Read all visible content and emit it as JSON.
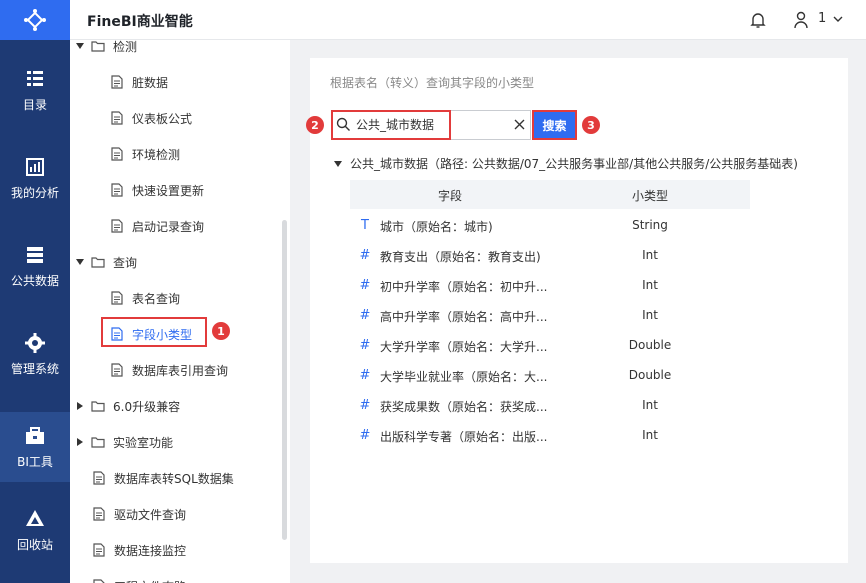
{
  "nav": {
    "items": [
      {
        "label": "目录",
        "icon": "catalog-icon"
      },
      {
        "label": "我的分析",
        "icon": "analysis-icon"
      },
      {
        "label": "公共数据",
        "icon": "public-data-icon"
      },
      {
        "label": "管理系统",
        "icon": "gear-icon"
      },
      {
        "label": "BI工具",
        "icon": "toolbox-icon"
      },
      {
        "label": "回收站",
        "icon": "recycle-icon"
      }
    ],
    "active_index": 4
  },
  "header": {
    "title": "FineBI商业智能",
    "user_count": "1"
  },
  "tree": {
    "rows": [
      {
        "text": "检测",
        "kind": "folder",
        "expanded": true
      },
      {
        "text": "脏数据",
        "kind": "doc"
      },
      {
        "text": "仪表板公式",
        "kind": "doc"
      },
      {
        "text": "环境检测",
        "kind": "doc"
      },
      {
        "text": "快速设置更新",
        "kind": "doc"
      },
      {
        "text": "启动记录查询",
        "kind": "doc"
      },
      {
        "text": "查询",
        "kind": "folder",
        "expanded": true
      },
      {
        "text": "表名查询",
        "kind": "doc"
      },
      {
        "text": "字段小类型",
        "kind": "doc",
        "selected": true
      },
      {
        "text": "数据库表引用查询",
        "kind": "doc"
      },
      {
        "text": "6.0升级兼容",
        "kind": "folder",
        "expanded": false
      },
      {
        "text": "实验室功能",
        "kind": "folder",
        "expanded": false
      },
      {
        "text": "数据库表转SQL数据集",
        "kind": "doc"
      },
      {
        "text": "驱动文件查询",
        "kind": "doc"
      },
      {
        "text": "数据连接监控",
        "kind": "doc"
      },
      {
        "text": "工程文件态路",
        "kind": "doc"
      }
    ]
  },
  "badges": [
    "1",
    "2",
    "3"
  ],
  "main": {
    "hint": "根据表名（转义）查询其字段的小类型",
    "search_value": "公共_城市数据",
    "search_button": "搜索",
    "result_title": "公共_城市数据（路径: 公共数据/07_公共服务事业部/其他公共服务/公共服务基础表)",
    "columns": [
      "字段",
      "小类型"
    ],
    "rows": [
      {
        "icon": "text-type-icon",
        "glyph": "T",
        "field": "城市（原始名：城市)",
        "type": "String"
      },
      {
        "icon": "number-type-icon",
        "glyph": "#",
        "field": "教育支出（原始名：教育支出)",
        "type": "Int"
      },
      {
        "icon": "number-type-icon",
        "glyph": "#",
        "field": "初中升学率（原始名：初中升...",
        "type": "Int"
      },
      {
        "icon": "number-type-icon",
        "glyph": "#",
        "field": "高中升学率（原始名：高中升...",
        "type": "Int"
      },
      {
        "icon": "number-type-icon",
        "glyph": "#",
        "field": "大学升学率（原始名：大学升...",
        "type": "Double"
      },
      {
        "icon": "number-type-icon",
        "glyph": "#",
        "field": "大学毕业就业率（原始名：大...",
        "type": "Double"
      },
      {
        "icon": "number-type-icon",
        "glyph": "#",
        "field": "获奖成果数（原始名：获奖成...",
        "type": "Int"
      },
      {
        "icon": "number-type-icon",
        "glyph": "#",
        "field": "出版科学专著（原始名：出版...",
        "type": "Int"
      }
    ]
  },
  "colors": {
    "nav_bg": "#1e3a74",
    "accent": "#2f6cf0",
    "annotation_red": "#e23b3b"
  }
}
